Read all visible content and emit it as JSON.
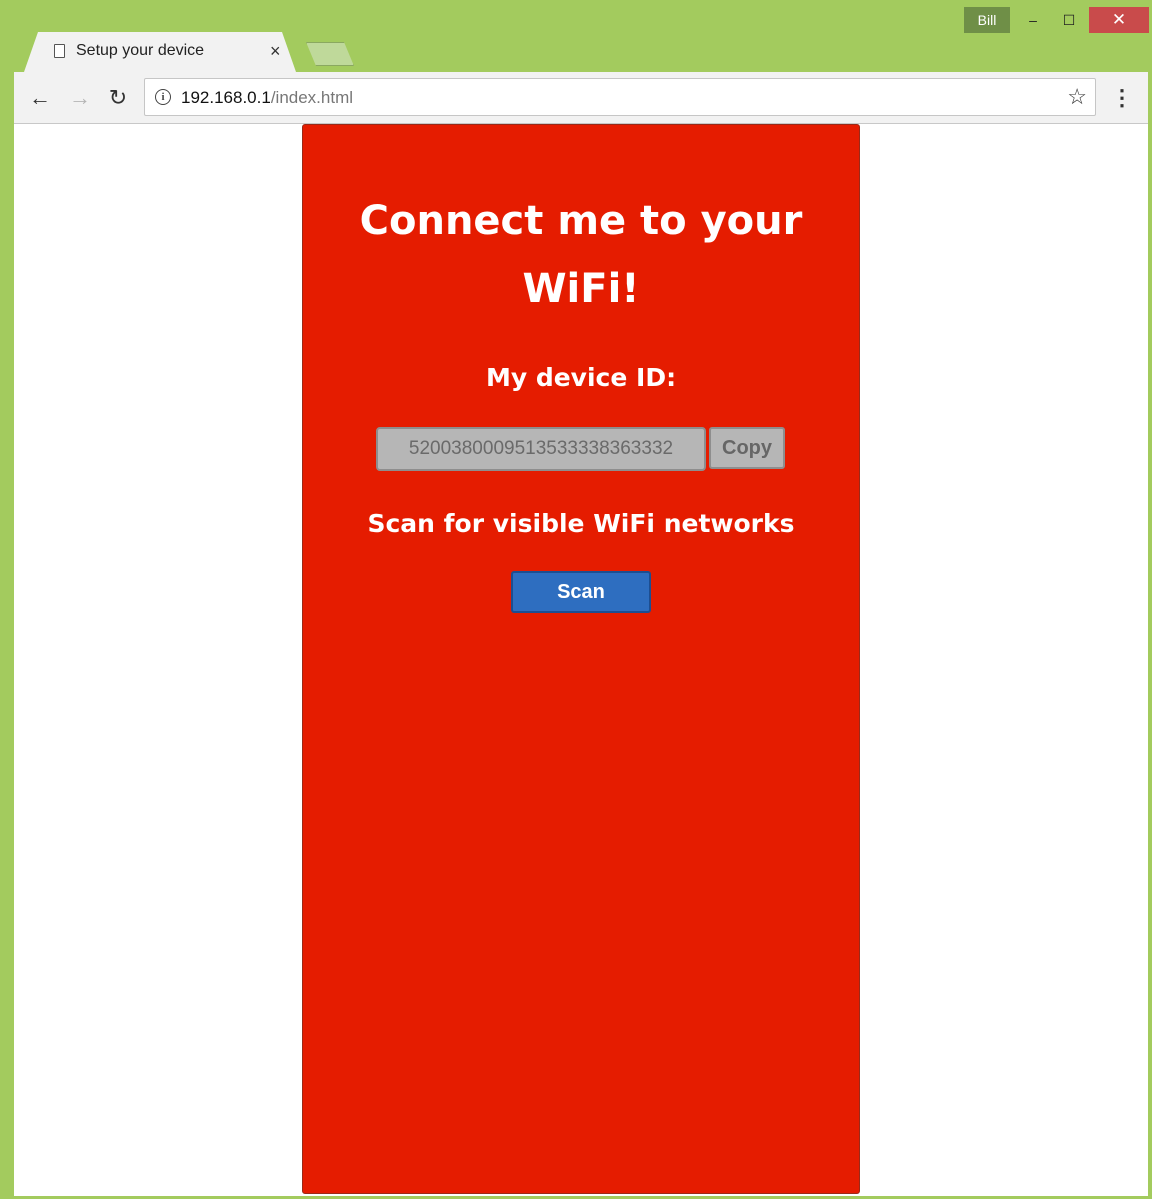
{
  "browser": {
    "user": "Bill",
    "tab": {
      "title": "Setup your device",
      "close_icon": "close-icon"
    },
    "url": {
      "host": "192.168.0.1",
      "path": "/index.html"
    },
    "window_controls": {
      "minimize": "–",
      "maximize": "☐",
      "close": "✕"
    },
    "nav": {
      "back": "←",
      "forward": "→",
      "reload": "↻",
      "info": "i",
      "star": "☆",
      "menu": "⋮"
    },
    "frame_color": "#a3cb5e"
  },
  "page": {
    "heading_line1": "Connect me to your",
    "heading_line2": "WiFi!",
    "device_label": "My device ID:",
    "device_id": "5200380009513533338363332",
    "copy_label": "Copy",
    "scan_label": "Scan for visible WiFi networks",
    "scan_button": "Scan",
    "card_color": "#e51c00",
    "scan_button_color": "#2e6ec0"
  }
}
